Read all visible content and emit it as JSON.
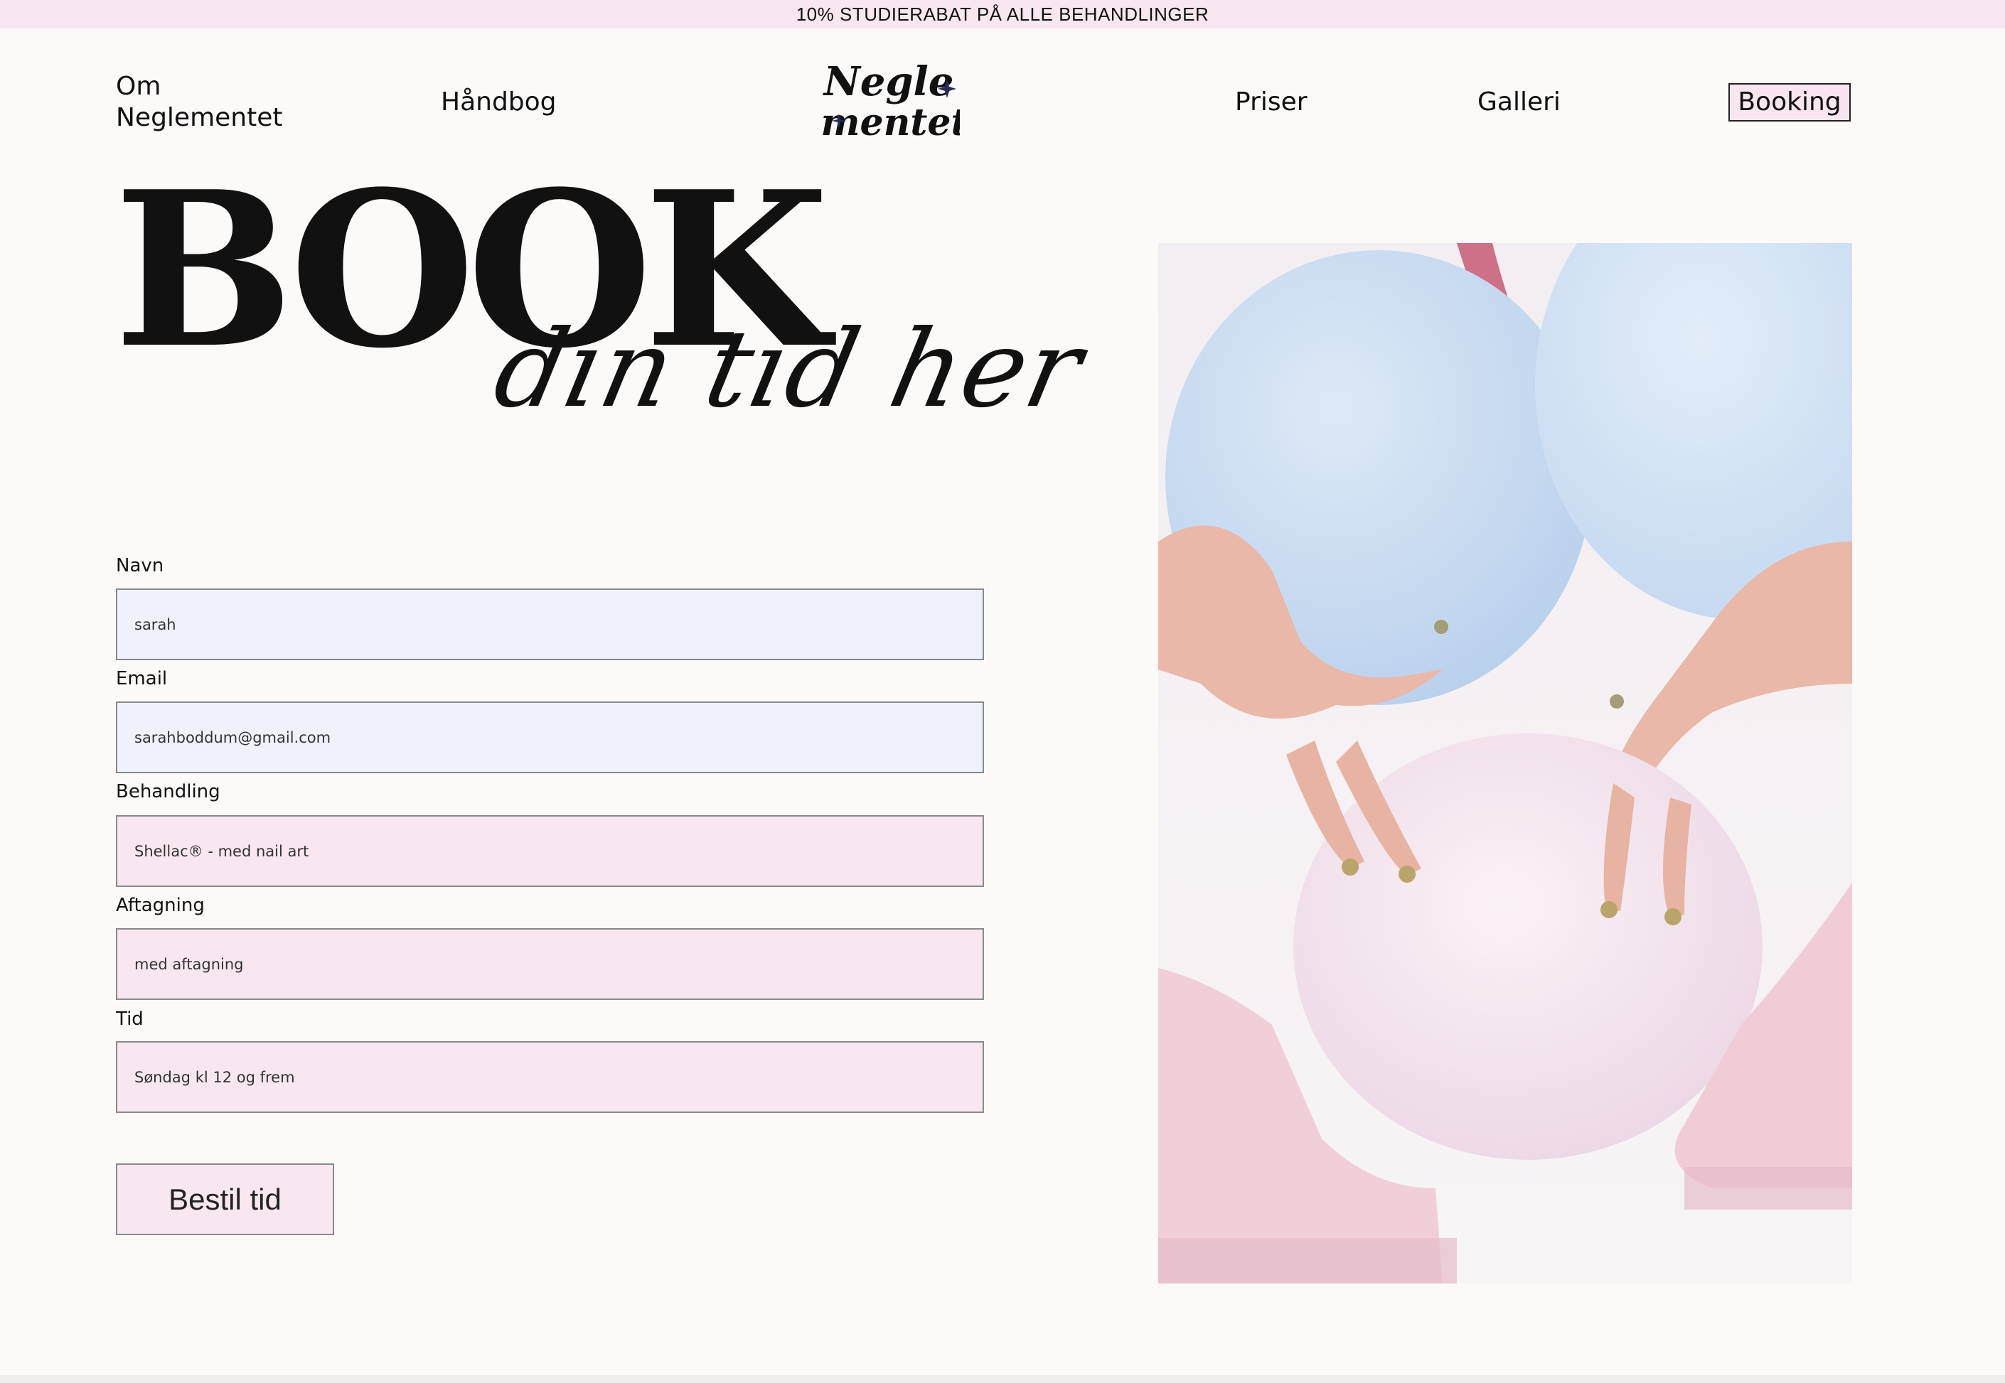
{
  "promo": {
    "text": "10% STUDIERABAT PÅ ALLE BEHANDLINGER"
  },
  "nav": {
    "om": "Om Neglementet",
    "handbog": "Håndbog",
    "priser": "Priser",
    "galleri": "Galleri",
    "booking": "Booking"
  },
  "logo": {
    "line1": "Negle",
    "line2": "mentet"
  },
  "hero": {
    "title": "BOOK",
    "script": "din tid her"
  },
  "form": {
    "fields": [
      {
        "label": "Navn",
        "value": "sarah"
      },
      {
        "label": "Email",
        "value": "sarahboddum@gmail.com"
      },
      {
        "label": "Behandling",
        "value": "Shellac® - med nail art"
      },
      {
        "label": "Aftagning",
        "value": "med aftagning"
      },
      {
        "label": "Tid",
        "value": "Søndag kl 12 og frem"
      }
    ],
    "submit": "Bestil tid"
  },
  "colors": {
    "background": "#fbfaf9",
    "pink": "#f8e7f1",
    "blue_field": "#eef3fb"
  }
}
